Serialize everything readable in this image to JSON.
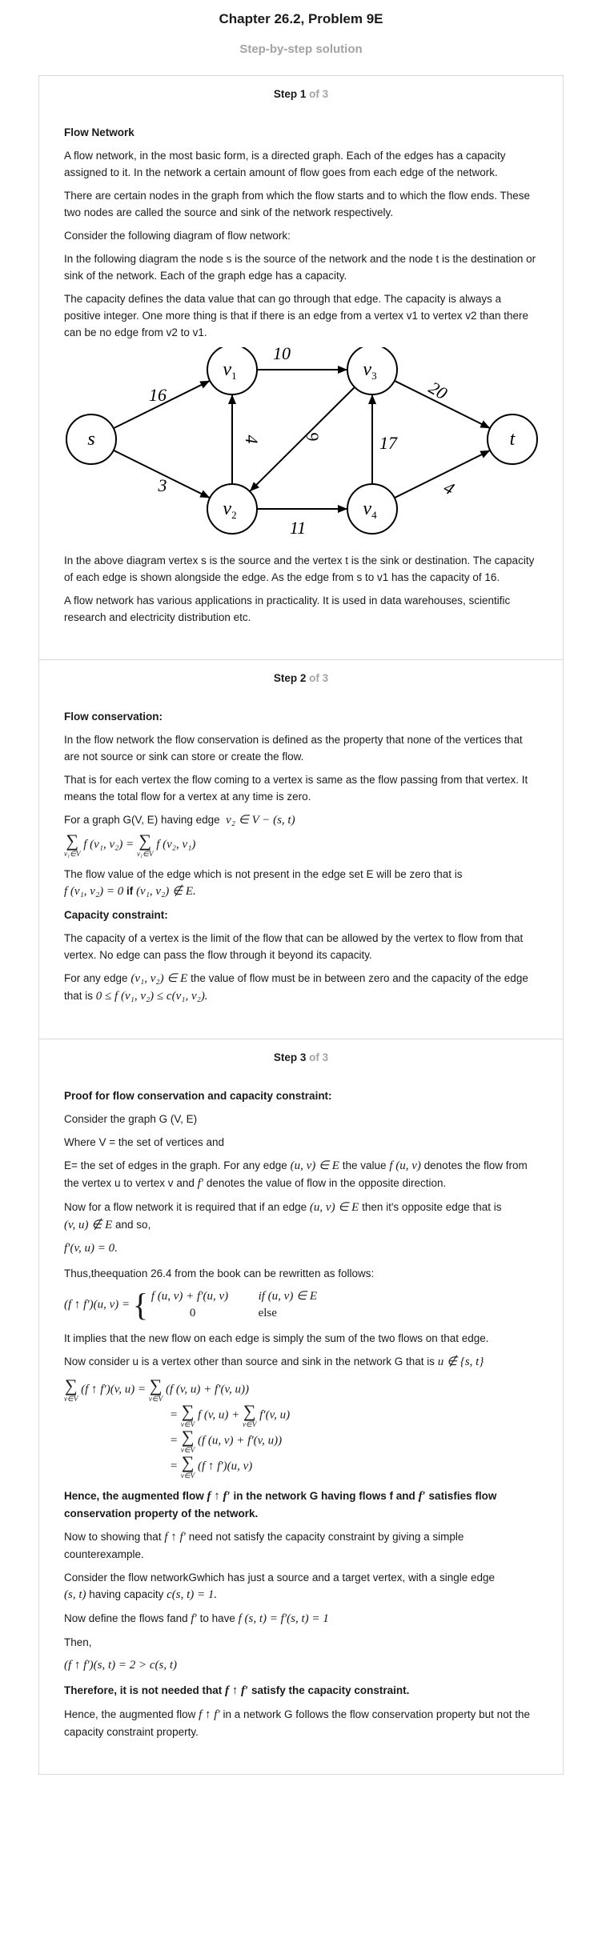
{
  "header": {
    "chapter_title": "Chapter 26.2, Problem 9E",
    "subtitle": "Step-by-step solution"
  },
  "steps": [
    {
      "label": "Step 1",
      "of": "of 3",
      "heading": "Flow Network",
      "p1": "A flow network, in the most basic form, is a directed graph. Each of the edges has a capacity assigned to it. In the network a certain amount of flow goes from each edge of the network.",
      "p2": "There are certain nodes in the graph from which the flow starts and to which the flow ends. These two nodes are called the source and sink of the network respectively.",
      "p3": "Consider the following diagram of flow network:",
      "p4": "In the following diagram the node s is the source of the network and the node t is the destination or sink of the network. Each of the graph edge has a capacity.",
      "p5": "The capacity defines the data value that can go through that edge. The capacity is always a positive integer. One more thing is that if there is an edge from a vertex v1 to vertex v2 than there can be no edge from v2 to v1.",
      "p6": "In the above diagram vertex s is the source and the vertex t is the sink or destination. The capacity of each edge is shown alongside the edge. As the edge from s to v1 has the capacity of 16.",
      "p7": "A flow network has various applications in practicality. It is used in data warehouses, scientific research and electricity distribution etc."
    },
    {
      "label": "Step 2",
      "of": "of 3",
      "heading": "Flow conservation:",
      "p1": "In the flow network the flow conservation is defined as the property that none of the vertices that are not source or sink can store or create the flow.",
      "p2": "That is for each vertex the flow coming to a vertex is same as the flow passing from that vertex. It means the total flow for a vertex at any time is zero.",
      "p3a": "For a graph G(V, E) having edge",
      "eq_edge": "v₂ ∈ V − (s, t)",
      "eq_cons_lhs": "f (v₁, v₂) = ",
      "eq_cons_rhs": "f (v₂, v₁)",
      "sum_sub": "v₁∈V",
      "sum_sign": "∑",
      "p4a": "The flow value of the edge which is not present in the edge set E will be zero that is",
      "eq_zero": "f (v₁, v₂) = 0",
      "if_word": "if",
      "eq_notin": "(v₁, v₂) ∉ E.",
      "heading2": "Capacity constraint:",
      "p5": "The capacity of a vertex is the limit of the flow that can be allowed by the vertex to flow from that vertex. No edge can pass the flow through it beyond its capacity.",
      "p6a": "For any edge",
      "eq_in": "(v₁, v₂) ∈ E",
      "p6b": "the value of flow must be in between zero and the capacity of the edge that is",
      "eq_cap": "0 ≤ f (v₁, v₂) ≤ c(v₁, v₂)."
    },
    {
      "label": "Step 3",
      "of": "of 3",
      "heading": "Proof for flow conservation and capacity constraint:",
      "p1": "Consider the graph G (V, E)",
      "p2": "Where V = the set of vertices and",
      "p3a": "E= the set of edges in the graph. For any edge",
      "eq_uv_in": "(u, v) ∈ E",
      "p3b": "the value",
      "eq_fuv": "f (u, v)",
      "p3c": "denotes the flow from the vertex u to vertex v and",
      "eq_fprime": "f′",
      "p3d": "denotes the value of flow in the opposite direction.",
      "p4a": "Now for a flow network it is required that if an edge",
      "p4b": "then it's opposite edge that is",
      "eq_vu_notin": "(v, u) ∉ E",
      "p4c": "and so,",
      "eq_fprime_zero": "f′(v, u) = 0.",
      "p5": "Thus,theequation 26.4 from the book can be rewritten as follows:",
      "eq_aug_lhs": "(f ↑ f′)(u, v) = ",
      "case1_expr": "f (u, v) + f′(u, v)",
      "case1_cond": "if (u, v) ∈ E",
      "case2_expr": "0",
      "case2_cond": "else",
      "p6": "It implies that the new flow on each edge is simply the sum of the two flows on that edge.",
      "p7a": "Now consider u is a vertex other than source and sink in the network G that is",
      "eq_u_notin": "u ∉ {s, t}",
      "sum_sub_v": "v∈V",
      "sum_l1_lhs": "(f ↑ f′)(v, u) = ",
      "sum_l1_rhs": "(f (v, u) + f′(v, u))",
      "sum_l2_a": "f (v, u) + ",
      "sum_l2_b": "f′(v, u)",
      "sum_l3": "(f (u, v) + f′(v, u))",
      "sum_l4": "(f ↑ f′)(u, v)",
      "bold1a": "Hence, the augmented flow",
      "eq_aug": "f ↑ f′",
      "bold1b": "in the network G having flows f and",
      "bold1c": "satisfies flow conservation property of the network.",
      "p8a": "Now to showing that",
      "p8b": "need not satisfy the capacity constraint by giving a simple counterexample.",
      "p9a": "Consider the flow networkGwhich has just a source and a target vertex, with a single edge",
      "eq_st": "(s, t)",
      "p9b": "having capacity",
      "eq_cst": "c(s, t) = 1.",
      "p10a": "Now define the flows fand",
      "p10b": "to have",
      "eq_fst": "f (s, t) = f′(s, t) = 1",
      "p11": "Then,",
      "eq_then": "(f ↑ f′)(s, t) = 2 > c(s, t)",
      "bold2a": "Therefore, it is not needed that",
      "bold2b": "satisfy the capacity constraint.",
      "p12a": "Hence, the augmented flow",
      "p12b": "in a network G follows the flow conservation property but not the capacity constraint property."
    }
  ],
  "diagram": {
    "nodes": [
      {
        "id": "s",
        "label": "s",
        "sub": ""
      },
      {
        "id": "v1",
        "label": "v",
        "sub": "1"
      },
      {
        "id": "v2",
        "label": "v",
        "sub": "2"
      },
      {
        "id": "v3",
        "label": "v",
        "sub": "3"
      },
      {
        "id": "v4",
        "label": "v",
        "sub": "4"
      },
      {
        "id": "t",
        "label": "t",
        "sub": ""
      }
    ],
    "edges": [
      {
        "from": "s",
        "to": "v1",
        "capacity": "16"
      },
      {
        "from": "s",
        "to": "v2",
        "capacity": "3"
      },
      {
        "from": "v2",
        "to": "v1",
        "capacity": "4"
      },
      {
        "from": "v1",
        "to": "v3",
        "capacity": "10"
      },
      {
        "from": "v3",
        "to": "v2",
        "capacity": "9"
      },
      {
        "from": "v2",
        "to": "v4",
        "capacity": "11"
      },
      {
        "from": "v4",
        "to": "v3",
        "capacity": "17"
      },
      {
        "from": "v3",
        "to": "t",
        "capacity": "20"
      },
      {
        "from": "v4",
        "to": "t",
        "capacity": "4"
      }
    ]
  }
}
